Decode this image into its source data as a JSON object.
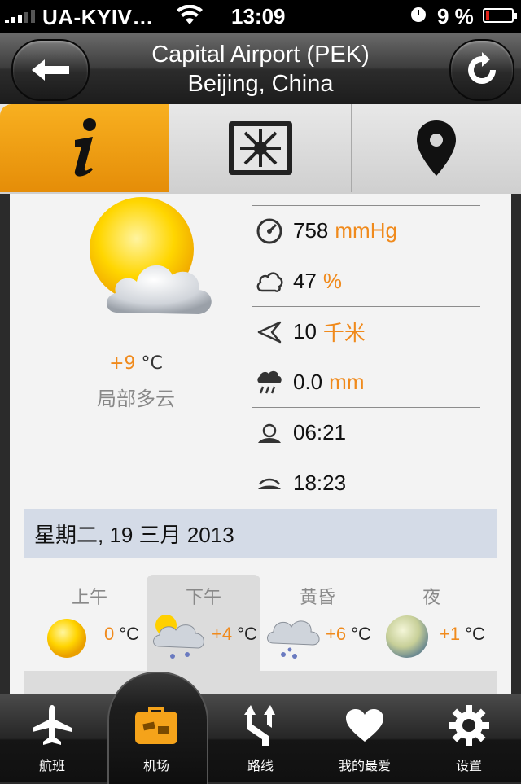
{
  "status_bar": {
    "carrier": "UA-KYIV…",
    "time": "13:09",
    "battery_percent": "9 %",
    "battery_level": 0.09
  },
  "nav": {
    "title_line1": "Capital Airport (PEK)",
    "title_line2": "Beijing, China",
    "back_icon": "back-arrow-icon",
    "refresh_icon": "refresh-icon"
  },
  "segments": [
    {
      "icon": "info-icon",
      "active": true
    },
    {
      "icon": "hub-icon",
      "active": false
    },
    {
      "icon": "map-pin-icon",
      "active": false
    }
  ],
  "weather": {
    "temp_value": "+9",
    "temp_unit": "°C",
    "condition": "局部多云",
    "stats": [
      {
        "icon": "pressure-gauge-icon",
        "value": "758",
        "unit": "mmHg"
      },
      {
        "icon": "humidity-cloud-icon",
        "value": "47",
        "unit": "%"
      },
      {
        "icon": "wind-icon",
        "value": "10",
        "unit": "千米"
      },
      {
        "icon": "precipitation-icon",
        "value": "0.0",
        "unit": "mm"
      },
      {
        "icon": "sunrise-icon",
        "value": "06:21",
        "unit": ""
      },
      {
        "icon": "sunset-icon",
        "value": "18:23",
        "unit": ""
      }
    ]
  },
  "date_bar": "星期二, 19 三月 2013",
  "forecast": [
    {
      "label": "上午",
      "temp": "0",
      "unit": "°C",
      "icon": "sun-icon"
    },
    {
      "label": "下午",
      "temp": "+4",
      "unit": "°C",
      "icon": "sun-cloud-snow-icon"
    },
    {
      "label": "黄昏",
      "temp": "+6",
      "unit": "°C",
      "icon": "cloud-snow-icon"
    },
    {
      "label": "夜",
      "temp": "+1",
      "unit": "°C",
      "icon": "moon-icon"
    }
  ],
  "tabbar": [
    {
      "label": "航班",
      "icon": "airplane-icon",
      "active": false
    },
    {
      "label": "机场",
      "icon": "suitcase-icon",
      "active": true
    },
    {
      "label": "路线",
      "icon": "route-icon",
      "active": false
    },
    {
      "label": "我的最爱",
      "icon": "heart-icon",
      "active": false
    },
    {
      "label": "设置",
      "icon": "gear-icon",
      "active": false
    }
  ],
  "colors": {
    "accent_orange": "#f08a1c",
    "active_tab_orange": "#f5a31a",
    "date_bar_bg": "#d4dbe7"
  }
}
